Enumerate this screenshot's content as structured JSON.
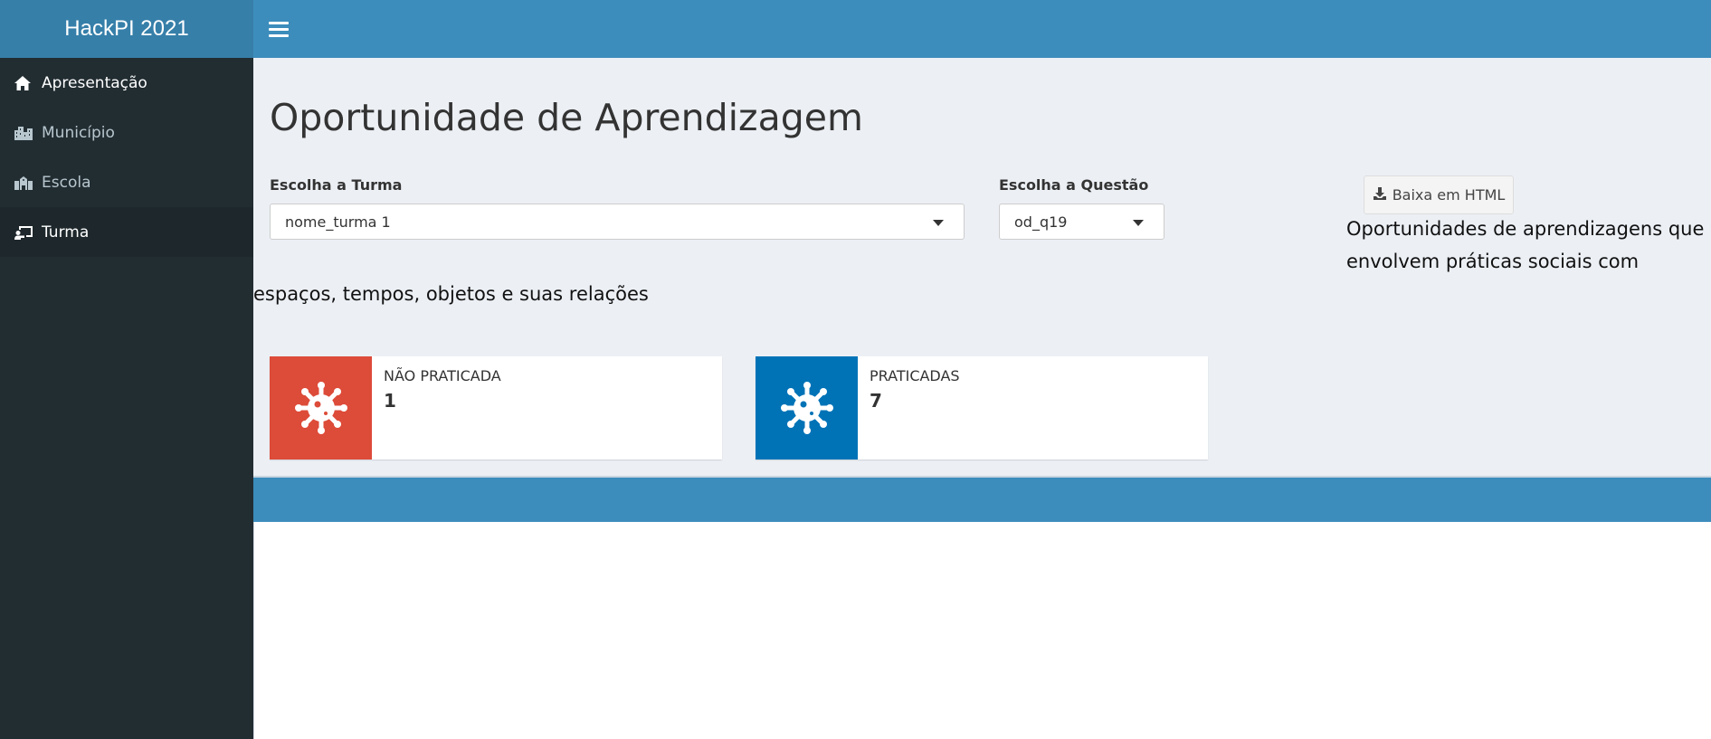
{
  "app": {
    "title": "HackPI 2021"
  },
  "sidebar": {
    "items": [
      {
        "label": "Apresentação",
        "icon": "home-icon"
      },
      {
        "label": "Município",
        "icon": "city-icon"
      },
      {
        "label": "Escola",
        "icon": "school-icon"
      },
      {
        "label": "Turma",
        "icon": "chalkboard-teacher-icon"
      }
    ]
  },
  "main": {
    "title": "Oportunidade de Aprendizagem",
    "turma": {
      "label": "Escolha a Turma",
      "value": "nome_turma 1"
    },
    "questao": {
      "label": "Escolha a Questão",
      "value": "od_q19"
    },
    "download_label": "Baixa em HTML",
    "question_text": {
      "line1": "Oportunidades de aprendizagens que",
      "line2": "envolvem práticas sociais com",
      "line3": "espaços, tempos, objetos e suas relações"
    },
    "infoboxes": [
      {
        "label": "NÃO PRATICADA",
        "value": "1",
        "color": "#dd4b39",
        "icon": "virus-icon"
      },
      {
        "label": "PRATICADAS",
        "value": "7",
        "color": "#0073b7",
        "icon": "virus-icon"
      }
    ]
  },
  "colors": {
    "header": "#3c8dbc",
    "logo": "#367fa9",
    "sidebar": "#222d32",
    "content_bg": "#ecf0f5"
  }
}
